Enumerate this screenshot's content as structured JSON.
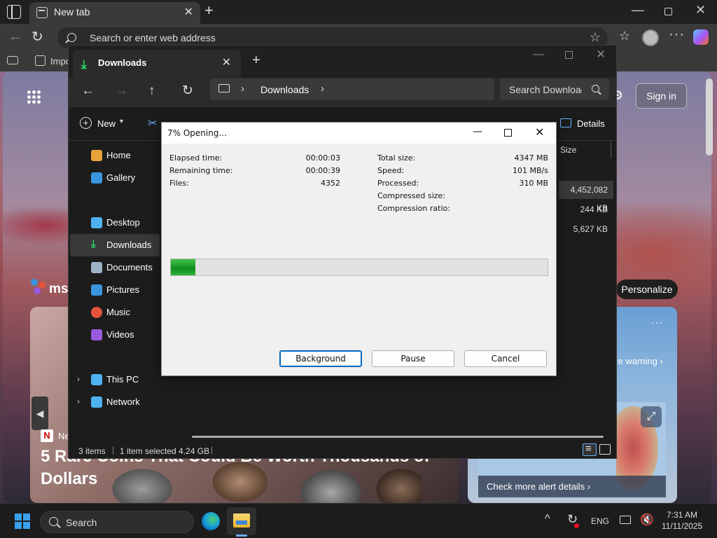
{
  "browser": {
    "tab_title": "New tab",
    "address_placeholder": "Search or enter web address",
    "favorites_bar_item": "Impo",
    "new_tab_symbol": "+",
    "close_symbol": "✕"
  },
  "page": {
    "signin_label": "Sign in",
    "personalize_label": "Personalize",
    "msn_label": "ms",
    "news_source_letter": "N",
    "news_source_name": "Ne",
    "headline": "5 Rare Coins That Could Be Worth Thousands of Dollars",
    "warning_text": "ze warning ›",
    "alert_link": "Check more alert details ›"
  },
  "explorer": {
    "tab_title": "Downloads",
    "path_label": "Downloads",
    "search_placeholder": "Search Downloads",
    "new_label": "New",
    "details_label": "Details",
    "sidebar": [
      {
        "label": "Home",
        "icon": "home-icon",
        "color": "#e8a33d"
      },
      {
        "label": "Gallery",
        "icon": "gallery-icon",
        "color": "#3a96dd"
      },
      {
        "label": "Desktop",
        "icon": "desktop-icon",
        "color": "#4fb2f0"
      },
      {
        "label": "Downloads",
        "icon": "downloads-icon",
        "color": "#2dd46a"
      },
      {
        "label": "Documents",
        "icon": "documents-icon",
        "color": "#9fb3c8"
      },
      {
        "label": "Pictures",
        "icon": "pictures-icon",
        "color": "#3a96dd"
      },
      {
        "label": "Music",
        "icon": "music-icon",
        "color": "#e5543a"
      },
      {
        "label": "Videos",
        "icon": "videos-icon",
        "color": "#9a5ae0"
      },
      {
        "label": "This PC",
        "icon": "this-pc-icon",
        "color": "#4fb2f0"
      },
      {
        "label": "Network",
        "icon": "network-icon",
        "color": "#4fb2f0"
      }
    ],
    "column_size": "Size",
    "rows": [
      "4,452,082 KB",
      "244 KB",
      "5,627 KB"
    ],
    "status_items": "3 items",
    "status_selected": "1 item selected  4.24 GB"
  },
  "dialog": {
    "title": "7% Opening...",
    "progress_fraction": 0.065,
    "left_labels": [
      "Elapsed time:",
      "Remaining time:",
      "Files:"
    ],
    "left_values": [
      "00:00:03",
      "00:00:39",
      "4352"
    ],
    "right_labels": [
      "Total size:",
      "Speed:",
      "Processed:",
      "Compressed size:",
      "Compression ratio:"
    ],
    "right_values": [
      "4347 MB",
      "101 MB/s",
      "310 MB",
      "",
      ""
    ],
    "buttons": {
      "background": "Background",
      "pause": "Pause",
      "cancel": "Cancel"
    }
  },
  "taskbar": {
    "search_label": "Search",
    "language": "ENG",
    "time": "7:31 AM",
    "date": "11/11/2025"
  }
}
